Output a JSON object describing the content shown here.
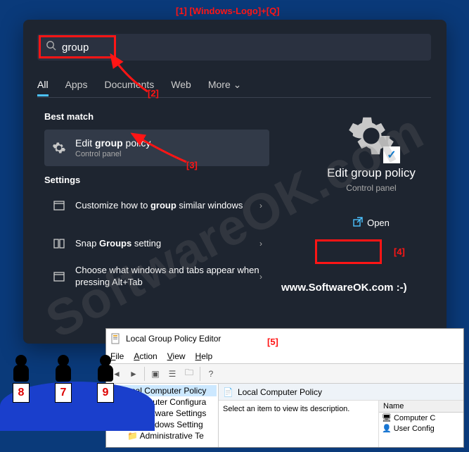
{
  "annotations": {
    "a1": "[1]  [Windows-Logo]+[Q]",
    "a2": "[2]",
    "a3": "[3]",
    "a4": "[4]",
    "a5": "[5]"
  },
  "search": {
    "query": "group"
  },
  "tabs": {
    "all": "All",
    "apps": "Apps",
    "documents": "Documents",
    "web": "Web",
    "more": "More"
  },
  "sections": {
    "best_match": "Best match",
    "settings": "Settings"
  },
  "best_result": {
    "title_pre": "Edit ",
    "title_bold": "group",
    "title_post": " policy",
    "subtitle": "Control panel"
  },
  "settings_items": {
    "s1_pre": "Customize how to ",
    "s1_bold": "group",
    "s1_post": " similar windows",
    "s2_pre": "Snap ",
    "s2_bold": "Groups",
    "s2_post": " setting",
    "s3": "Choose what windows and tabs appear when pressing Alt+Tab"
  },
  "detail": {
    "title": "Edit group policy",
    "subtitle": "Control panel",
    "open": "Open"
  },
  "lgpe": {
    "title": "Local Group Policy Editor",
    "menu": {
      "file": "File",
      "action": "Action",
      "view": "View",
      "help": "Help"
    },
    "tree": {
      "root": "Local Computer Policy",
      "n1": "Computer Configura",
      "n2": "Software Settings",
      "n3": "Windows Setting",
      "n4": "Administrative Te"
    },
    "content": {
      "header": "Local Computer Policy",
      "desc": "Select an item to view its description.",
      "col_name": "Name",
      "item1": "Computer C",
      "item2": "User Config"
    }
  },
  "watermark": "SoftwareOK.com",
  "wm_url": "www.SoftwareOK.com :-)",
  "cards": {
    "c8": "8",
    "c7": "7",
    "c9": "9"
  }
}
